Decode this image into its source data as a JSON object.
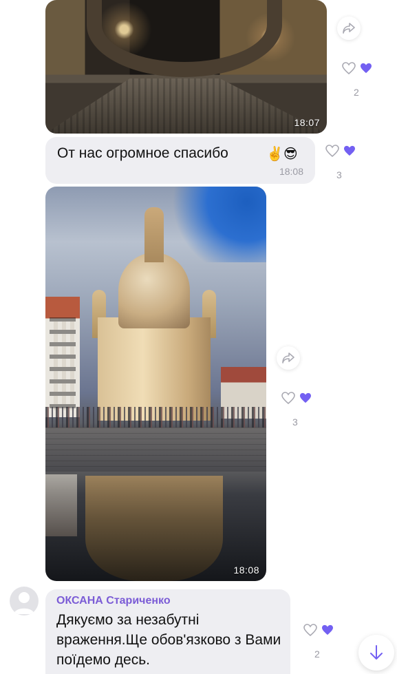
{
  "messages": [
    {
      "type": "photo",
      "time": "18:07",
      "reactions": {
        "count": "2"
      }
    },
    {
      "type": "text",
      "text": "От нас огромное спасибо",
      "emoji": "✌️😎",
      "time": "18:08",
      "reactions": {
        "count": "3"
      }
    },
    {
      "type": "photo",
      "time": "18:08",
      "reactions": {
        "count": "3"
      }
    },
    {
      "type": "text",
      "sender": "ОКСАНА Старичeнко",
      "text": "Дякуємо за незабутні враження.Ще обов'язково з Вами поїдемо десь.",
      "reactions": {
        "count": "2"
      }
    }
  ],
  "icons": {
    "forward": "forward-arrow-icon",
    "like_empty": "heart-outline-icon",
    "like_filled": "heart-filled-icon",
    "scroll_down": "arrow-down-icon",
    "avatar": "user-avatar-icon"
  },
  "colors": {
    "accent": "#7360f2",
    "sender_name": "#7b5cd6",
    "bubble": "#eeeef2",
    "muted_text": "#9a9aa3"
  }
}
